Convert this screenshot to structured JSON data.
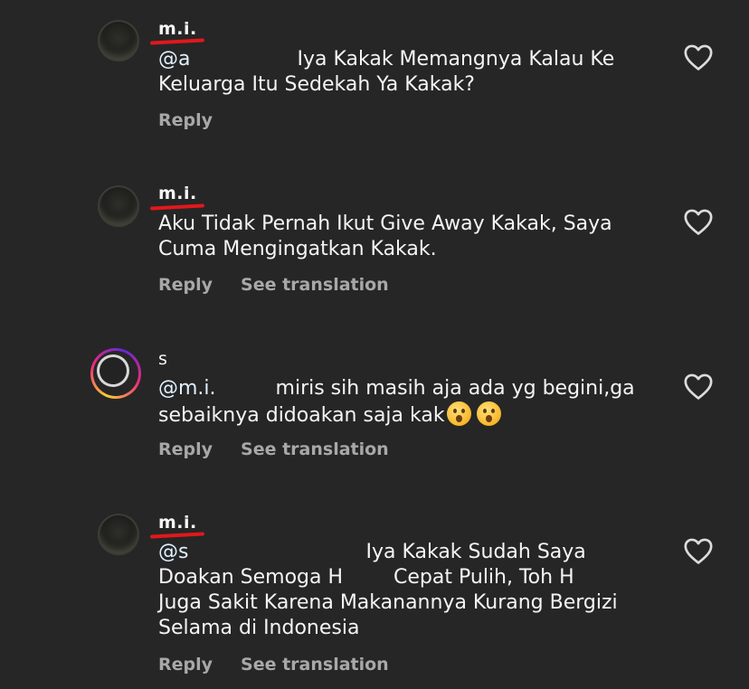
{
  "comments": [
    {
      "username": "m.i.",
      "line1_mention": "@a",
      "line1_text": "Iya Kakak Memangnya Kalau Ke",
      "line2": "Keluarga Itu Sedekah Ya Kakak?",
      "reply": "Reply"
    },
    {
      "username": "m.i.",
      "line1": "Aku Tidak Pernah Ikut Give Away Kakak, Saya",
      "line2": "Cuma Mengingatkan Kakak.",
      "reply": "Reply",
      "translate": "See translation"
    },
    {
      "username": "s",
      "line1_mention": "@m.i.",
      "line1_text": "miris sih masih aja ada yg begini,ga",
      "line2": "sebaiknya didoakan saja kak",
      "emoji": "surprised-face",
      "reply": "Reply",
      "translate": "See translation"
    },
    {
      "username": "m.i.",
      "line1_mention": "@s",
      "line1_text": "Iya Kakak Sudah Saya",
      "line2a": "Doakan Semoga H",
      "line2b": "Cepat Pulih, Toh H",
      "line3": "Juga Sakit Karena Makanannya Kurang Bergizi",
      "line4": "Selama di Indonesia",
      "reply": "Reply",
      "translate": "See translation"
    }
  ],
  "icons": {
    "like": "heart-outline-icon"
  },
  "colors": {
    "background": "#262626",
    "text": "#f5f5f5",
    "muted": "#a8a8a8",
    "highlight": "#e0181c"
  }
}
